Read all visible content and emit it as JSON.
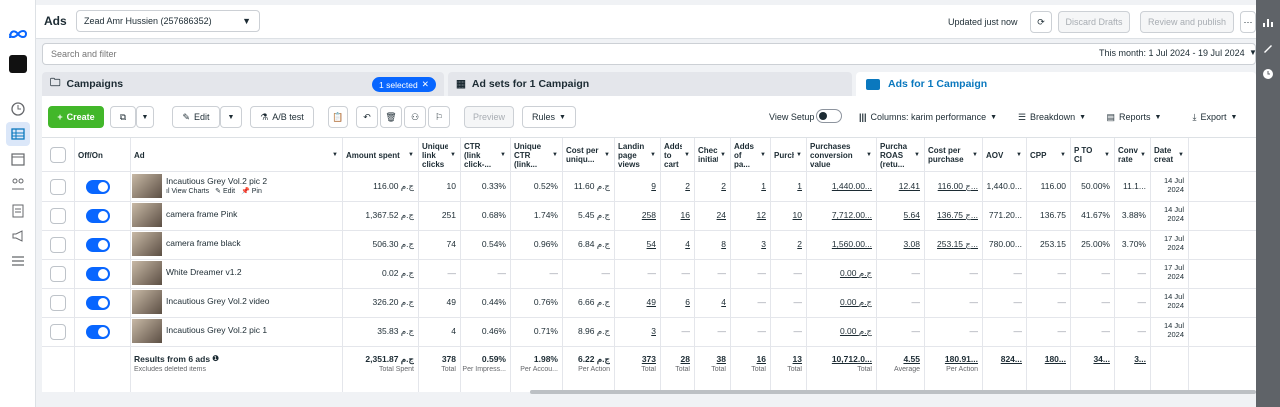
{
  "topbar": {
    "title": "Ads",
    "account": "Zead Amr Hussien (257686352)",
    "updated": "Updated just now",
    "discard": "Discard Drafts",
    "review": "Review and publish"
  },
  "search": {
    "placeholder": "Search and filter",
    "date_range": "This month: 1 Jul 2024 - 19 Jul 2024"
  },
  "tabs": {
    "campaigns": "Campaigns",
    "selected": "1 selected",
    "adsets": "Ad sets for 1 Campaign",
    "ads": "Ads for 1 Campaign"
  },
  "toolbar": {
    "create": "Create",
    "edit": "Edit",
    "ab_test": "A/B test",
    "preview": "Preview",
    "rules": "Rules",
    "view_setup": "View Setup",
    "columns": "Columns: karim performance",
    "breakdown": "Breakdown",
    "reports": "Reports",
    "export": "Export"
  },
  "table": {
    "headers": {
      "offon": "Off/On",
      "ad": "Ad",
      "c0": "Amount spent",
      "c1": "Unique link clicks",
      "c2": "CTR (link click-...",
      "c3": "Unique CTR (link...",
      "c4": "Cost per uniqu...",
      "c5": "Landin page views",
      "c6": "Adds to cart",
      "c7": "Check initiat",
      "c8": "Adds of pa...",
      "c9": "Purch",
      "c10": "Purchases conversion value",
      "c11": "Purcha ROAS (retu...",
      "c12": "Cost per purchase",
      "c13": "AOV",
      "c14": "CPP",
      "c15": "P TO CI",
      "c16": "Conve rate",
      "c17": "Date creat"
    },
    "row_actions": {
      "view_charts": "View Charts",
      "edit": "Edit",
      "pin": "Pin"
    },
    "rows": [
      {
        "name": "Incautious Grey Vol.2 pic 2",
        "c0": "116.00 ج.م",
        "c1": "10",
        "c2": "0.33%",
        "c3": "0.52%",
        "c4": "11.60 ج.م",
        "c5": "9",
        "c6": "2",
        "c7": "2",
        "c8": "1",
        "c9": "1",
        "c10": "1,440.00...",
        "c11": "12.41",
        "c12": "116.00 ج...",
        "c13": "1,440.0...",
        "c14": "116.00",
        "c15": "50.00%",
        "c16": "11.1...",
        "c17": "14 Jul 2024"
      },
      {
        "name": "camera frame Pink",
        "c0": "1,367.52 ج.م",
        "c1": "251",
        "c2": "0.68%",
        "c3": "1.74%",
        "c4": "5.45 ج.م",
        "c5": "258",
        "c6": "16",
        "c7": "24",
        "c8": "12",
        "c9": "10",
        "c10": "7,712.00...",
        "c11": "5.64",
        "c12": "136.75 ج...",
        "c13": "771.20...",
        "c14": "136.75",
        "c15": "41.67%",
        "c16": "3.88%",
        "c17": "14 Jul 2024"
      },
      {
        "name": "camera frame black",
        "c0": "506.30 ج.م",
        "c1": "74",
        "c2": "0.54%",
        "c3": "0.96%",
        "c4": "6.84 ج.م",
        "c5": "54",
        "c6": "4",
        "c7": "8",
        "c8": "3",
        "c9": "2",
        "c10": "1,560.00...",
        "c11": "3.08",
        "c12": "253.15 ج...",
        "c13": "780.00...",
        "c14": "253.15",
        "c15": "25.00%",
        "c16": "3.70%",
        "c17": "17 Jul 2024"
      },
      {
        "name": "White Dreamer v1.2",
        "c0": "0.02 ج.م",
        "c1": "—",
        "c2": "—",
        "c3": "—",
        "c4": "—",
        "c5": "—",
        "c6": "—",
        "c7": "—",
        "c8": "—",
        "c9": "—",
        "c10": "0.00 ج.م",
        "c11": "—",
        "c12": "—",
        "c13": "—",
        "c14": "—",
        "c15": "—",
        "c16": "—",
        "c17": "17 Jul 2024"
      },
      {
        "name": "Incautious Grey Vol.2 video",
        "c0": "326.20 ج.م",
        "c1": "49",
        "c2": "0.44%",
        "c3": "0.76%",
        "c4": "6.66 ج.م",
        "c5": "49",
        "c6": "6",
        "c7": "4",
        "c8": "—",
        "c9": "—",
        "c10": "0.00 ج.م",
        "c11": "—",
        "c12": "—",
        "c13": "—",
        "c14": "—",
        "c15": "—",
        "c16": "—",
        "c17": "14 Jul 2024"
      },
      {
        "name": "Incautious Grey Vol.2 pic 1",
        "c0": "35.83 ج.م",
        "c1": "4",
        "c2": "0.46%",
        "c3": "0.71%",
        "c4": "8.96 ج.م",
        "c5": "3",
        "c6": "—",
        "c7": "—",
        "c8": "—",
        "c9": "—",
        "c10": "0.00 ج.م",
        "c11": "—",
        "c12": "—",
        "c13": "—",
        "c14": "—",
        "c15": "—",
        "c16": "—",
        "c17": "14 Jul 2024"
      }
    ],
    "totals": {
      "label": "Results from 6 ads",
      "note": "Excludes deleted items",
      "c0": "2,351.87 ج.م",
      "c1": "378",
      "c2": "0.59%",
      "c3": "1.98%",
      "c4": "6.22 ج.م",
      "c5": "373",
      "c6": "28",
      "c7": "38",
      "c8": "16",
      "c9": "13",
      "c10": "10,712.0...",
      "c11": "4.55",
      "c12": "180.91...",
      "c13": "824...",
      "c14": "180...",
      "c15": "34...",
      "c16": "3...",
      "s0": "Total Spent",
      "s1": "Total",
      "s2": "Per Impress...",
      "s3": "Per Accou...",
      "s4": "Per Action",
      "s5": "Total",
      "s6": "Total",
      "s7": "Total",
      "s8": "Total",
      "s9": "Total",
      "s10": "Total",
      "s11": "Average",
      "s12": "Per Action"
    }
  },
  "colors": {
    "accent": "#0866ff",
    "create": "#42b72a",
    "link": "#0a78be"
  }
}
